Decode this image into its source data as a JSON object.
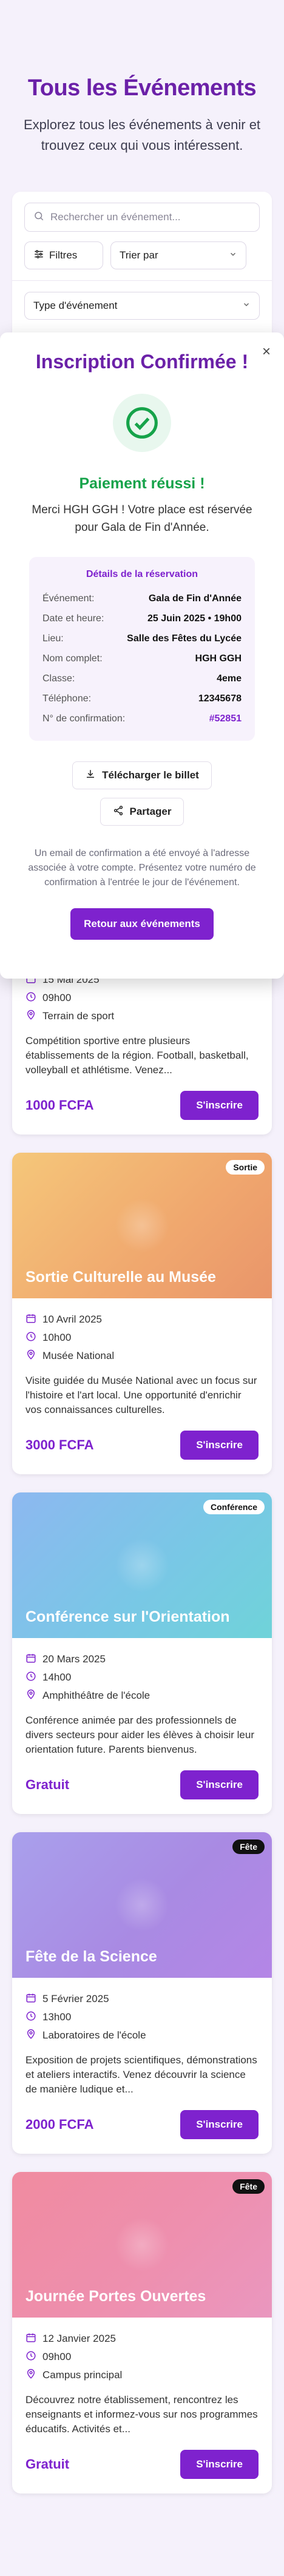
{
  "hero": {
    "title": "Tous les Événements",
    "subtitle": "Explorez tous les événements à venir et trouvez ceux qui vous intéressent."
  },
  "filters": {
    "search_placeholder": "Rechercher un événement...",
    "filters_label": "Filtres",
    "sort_label": "Trier par",
    "type_label": "Type d'événement"
  },
  "modal": {
    "title": "Inscription Confirmée !",
    "success": "Paiement réussi !",
    "thanks": "Merci HGH GGH ! Votre place est réservée pour Gala de Fin d'Année.",
    "details_title": "Détails de la réservation",
    "details": [
      {
        "k": "Événement:",
        "v": "Gala de Fin d'Année"
      },
      {
        "k": "Date et heure:",
        "v": "25 Juin 2025 • 19h00"
      },
      {
        "k": "Lieu:",
        "v": "Salle des Fêtes du Lycée"
      },
      {
        "k": "Nom complet:",
        "v": "HGH GGH"
      },
      {
        "k": "Classe:",
        "v": "4eme"
      },
      {
        "k": "Téléphone:",
        "v": "12345678"
      },
      {
        "k": "N° de confirmation:",
        "v": "#52851"
      }
    ],
    "download_label": "Télécharger le billet",
    "share_label": "Partager",
    "email_note": "Un email de confirmation a été envoyé à l'adresse associée à votre compte. Présentez votre numéro de confirmation à l'entrée le jour de l'événement.",
    "back_label": "Retour aux événements"
  },
  "events": [
    {
      "title": "",
      "badge": "",
      "date": "15 Mai 2025",
      "time": "09h00",
      "place": "Terrain de sport",
      "desc": "Compétition sportive entre plusieurs établissements de la région. Football, basketball, volleyball et athlétisme. Venez...",
      "price": "1000 FCFA",
      "cta": "S'inscrire"
    },
    {
      "title": "Sortie Culturelle au Musée",
      "badge": "Sortie",
      "date": "10 Avril 2025",
      "time": "10h00",
      "place": "Musée National",
      "desc": "Visite guidée du Musée National avec un focus sur l'histoire et l'art local. Une opportunité d'enrichir vos connaissances culturelles.",
      "price": "3000 FCFA",
      "cta": "S'inscrire"
    },
    {
      "title": "Conférence sur l'Orientation",
      "badge": "Conférence",
      "date": "20 Mars 2025",
      "time": "14h00",
      "place": "Amphithéâtre de l'école",
      "desc": "Conférence animée par des professionnels de divers secteurs pour aider les élèves à choisir leur orientation future. Parents bienvenus.",
      "price": "Gratuit",
      "cta": "S'inscrire"
    },
    {
      "title": "Fête de la Science",
      "badge": "Fête",
      "date": "5 Février 2025",
      "time": "13h00",
      "place": "Laboratoires de l'école",
      "desc": "Exposition de projets scientifiques, démonstrations et ateliers interactifs. Venez découvrir la science de manière ludique et...",
      "price": "2000 FCFA",
      "cta": "S'inscrire"
    },
    {
      "title": "Journée Portes Ouvertes",
      "badge": "Fête",
      "date": "12 Janvier 2025",
      "time": "09h00",
      "place": "Campus principal",
      "desc": "Découvrez notre établissement, rencontrez les enseignants et informez-vous sur nos programmes éducatifs. Activités et...",
      "price": "Gratuit",
      "cta": "S'inscrire"
    }
  ],
  "colors": {
    "accent": "#7e22ce",
    "success": "#16a34a"
  }
}
